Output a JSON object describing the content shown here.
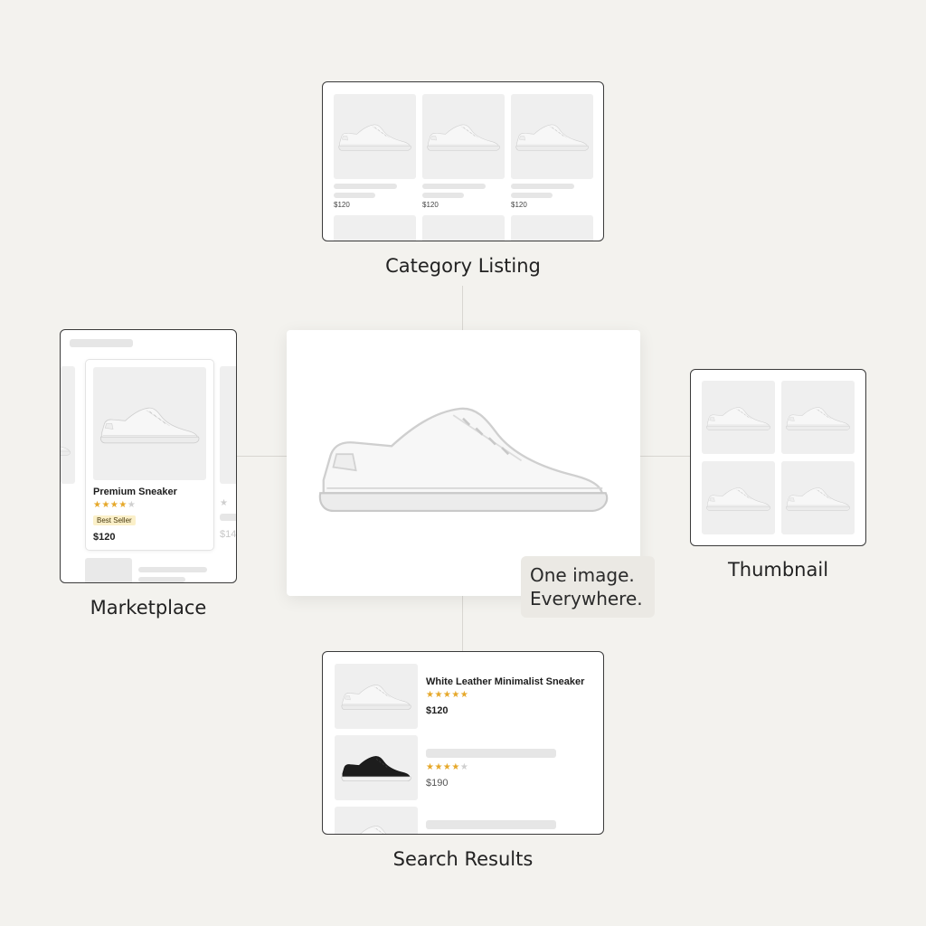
{
  "captions": {
    "category": "Category Listing",
    "marketplace": "Marketplace",
    "thumbnail": "Thumbnail",
    "search": "Search Results"
  },
  "tagline": {
    "line1": "One image.",
    "line2": "Everywhere."
  },
  "category": {
    "prices": [
      "$120",
      "$120",
      "$120"
    ]
  },
  "marketplace": {
    "product_name": "Premium Sneaker",
    "rating": 4,
    "badge": "Best Seller",
    "price": "$120",
    "peek_price": "$14"
  },
  "search": {
    "items": [
      {
        "title": "White Leather Minimalist Sneaker",
        "rating": 5,
        "price": "$120"
      },
      {
        "title": "",
        "rating": 4,
        "price": "$190"
      }
    ]
  },
  "colors": {
    "background": "#f3f2ee",
    "star": "#e6a82a",
    "badge_bg": "#fbf0c9",
    "frame_border": "#3a3a3a"
  },
  "icons": [
    "white-sneaker-icon",
    "black-sneaker-icon",
    "star-icon"
  ]
}
